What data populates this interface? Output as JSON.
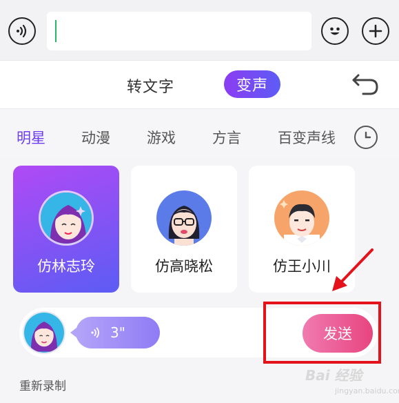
{
  "input_bar": {
    "voice_icon": "voice-wave-icon",
    "text_value": "",
    "emoji_icon": "smiley-icon",
    "plus_icon": "plus-icon"
  },
  "mode_row": {
    "text_mode": "转文字",
    "voice_mode": "变声",
    "undo_icon": "undo-icon"
  },
  "tabs": [
    {
      "label": "明星",
      "active": true
    },
    {
      "label": "动漫"
    },
    {
      "label": "游戏"
    },
    {
      "label": "方言"
    },
    {
      "label": "百变声线"
    }
  ],
  "history_icon": "clock-icon",
  "voices": [
    {
      "label": "仿林志玲",
      "selected": true
    },
    {
      "label": "仿高晓松"
    },
    {
      "label": "仿王小川"
    }
  ],
  "recording": {
    "duration": "3\"",
    "send_label": "发送",
    "rerecord_label": "重新录制"
  },
  "watermark": {
    "text": "Bai 经验",
    "sub": "jingyan.baidu.com"
  },
  "colors": {
    "accent": "#6d3df0",
    "send": "#e8457f",
    "highlight": "#e3121b"
  }
}
